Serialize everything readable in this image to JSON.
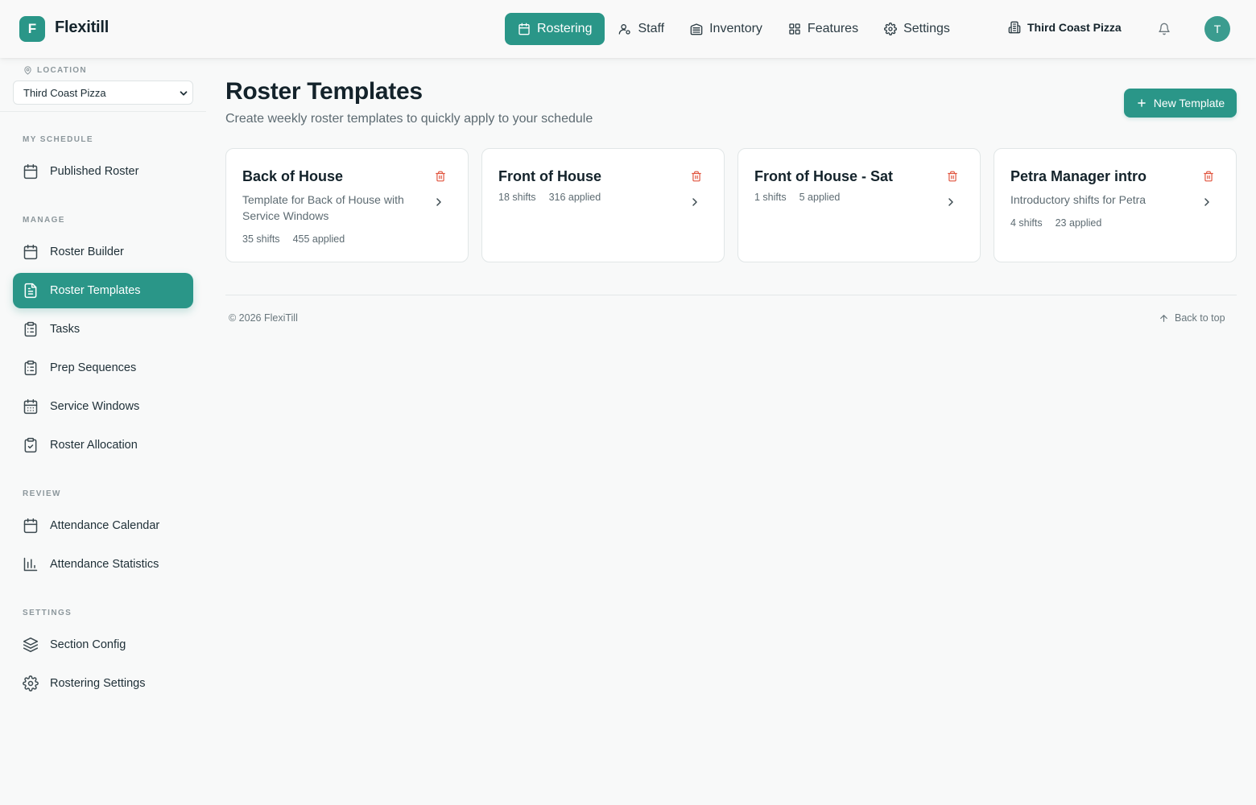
{
  "app": {
    "logo_letter": "F",
    "title": "Flexitill"
  },
  "topnav": {
    "items": [
      {
        "label": "Rostering",
        "icon": "calendar-icon",
        "active": true
      },
      {
        "label": "Staff",
        "icon": "user-icon"
      },
      {
        "label": "Inventory",
        "icon": "warehouse-icon"
      },
      {
        "label": "Features",
        "icon": "grid-icon"
      },
      {
        "label": "Settings",
        "icon": "gear-icon"
      }
    ],
    "org_name": "Third Coast Pizza",
    "avatar_letter": "T"
  },
  "sidebar": {
    "location_label": "LOCATION",
    "location_value": "Third Coast Pizza",
    "sections": {
      "my_schedule": "MY SCHEDULE",
      "manage": "MANAGE",
      "review": "REVIEW",
      "settings": "SETTINGS"
    },
    "items": {
      "published_roster": "Published Roster",
      "roster_builder": "Roster Builder",
      "roster_templates": "Roster Templates",
      "tasks": "Tasks",
      "prep_sequences": "Prep Sequences",
      "service_windows": "Service Windows",
      "roster_allocation": "Roster Allocation",
      "attendance_calendar": "Attendance Calendar",
      "attendance_statistics": "Attendance Statistics",
      "section_config": "Section Config",
      "rostering_settings": "Rostering Settings"
    },
    "active_item": "roster_templates"
  },
  "main": {
    "title": "Roster Templates",
    "subtitle": "Create weekly roster templates to quickly apply to your schedule",
    "new_button": "New Template",
    "templates": [
      {
        "name": "Back of House",
        "description": "Template for Back of House with Service Windows",
        "shifts": "35 shifts",
        "applied": "455 applied"
      },
      {
        "name": "Front of House",
        "description": "",
        "shifts": "18 shifts",
        "applied": "316 applied"
      },
      {
        "name": "Front of House - Sat",
        "description": "",
        "shifts": "1 shifts",
        "applied": "5 applied"
      },
      {
        "name": "Petra Manager intro",
        "description": "Introductory shifts for Petra",
        "shifts": "4 shifts",
        "applied": "23 applied"
      }
    ]
  },
  "footer": {
    "copyright": "© 2026 FlexiTill",
    "back_to_top": "Back to top"
  },
  "colors": {
    "accent": "#2a9688",
    "danger": "#e0533d",
    "text": "#14232b",
    "muted": "#5d6b72"
  }
}
